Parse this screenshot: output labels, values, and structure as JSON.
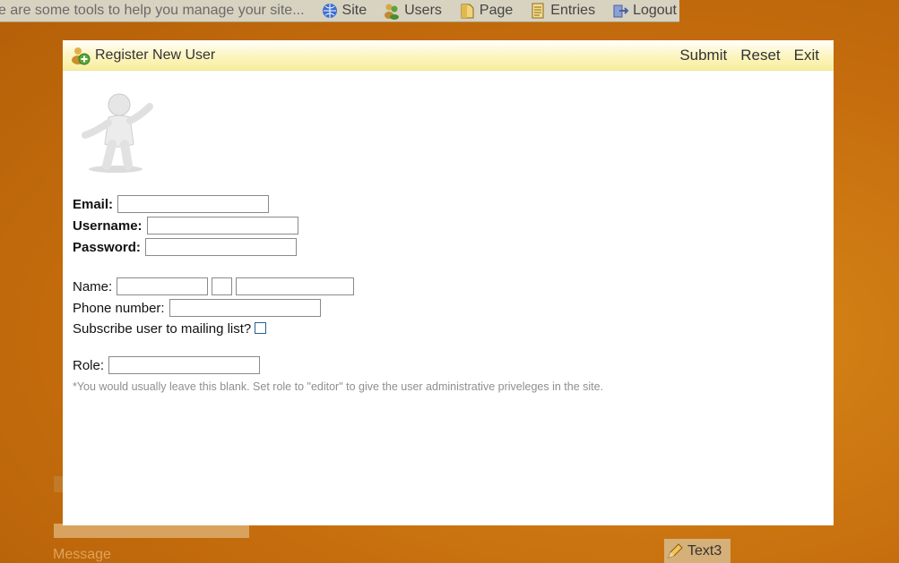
{
  "admin_bar": {
    "message": "e are some tools to help you manage your site...",
    "links": [
      {
        "label": "Site",
        "icon": "globe-icon"
      },
      {
        "label": "Users",
        "icon": "users-icon"
      },
      {
        "label": "Page",
        "icon": "page-icon"
      },
      {
        "label": "Entries",
        "icon": "entries-icon"
      },
      {
        "label": "Logout",
        "icon": "logout-icon"
      }
    ]
  },
  "background": {
    "tab_label": "Text3",
    "message_label": "Message"
  },
  "modal": {
    "title": "Register New User",
    "buttons": {
      "submit": "Submit",
      "reset": "Reset",
      "exit": "Exit"
    },
    "fields": {
      "email": {
        "label": "Email:",
        "value": ""
      },
      "username": {
        "label": "Username:",
        "value": ""
      },
      "password": {
        "label": "Password:",
        "value": ""
      },
      "name": {
        "label": "Name:",
        "first": "",
        "middle": "",
        "last": ""
      },
      "phone": {
        "label": "Phone number:",
        "value": ""
      },
      "subscribe": {
        "label": "Subscribe user to mailing list?",
        "checked": false
      },
      "role": {
        "label": "Role:",
        "value": ""
      }
    },
    "hint": "*You would usually leave this blank. Set role to \"editor\" to give the user administrative priveleges in the site."
  },
  "colors": {
    "page_background": "#c8700f",
    "header_gradient_end": "#f8ee9c",
    "checkbox_border": "#2a5f8f",
    "hint_text": "#8f8f8f"
  }
}
